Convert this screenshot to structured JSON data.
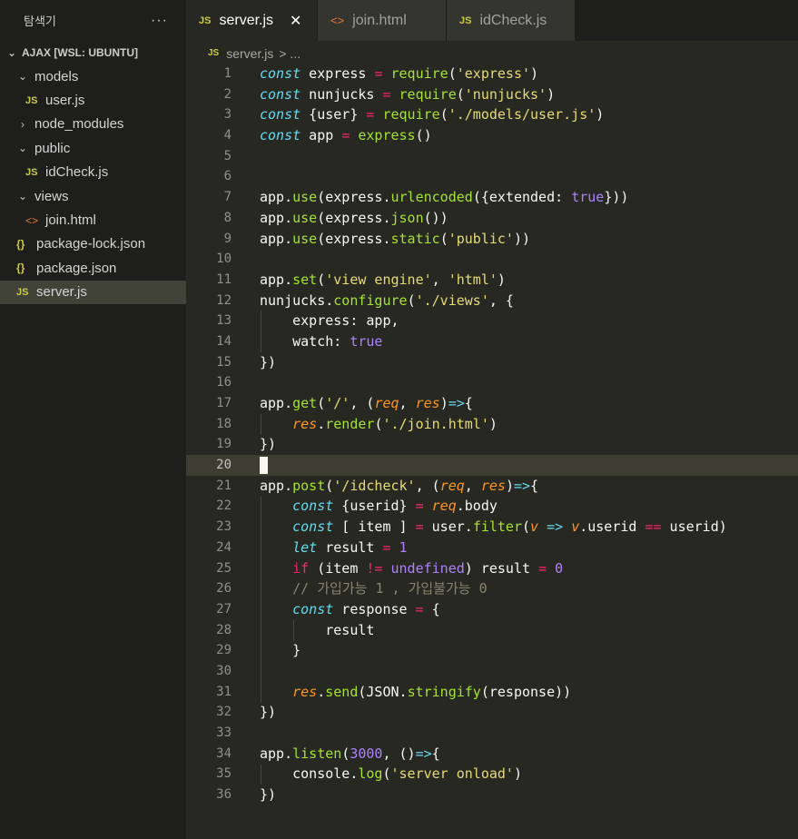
{
  "explorer": {
    "title": "탐색기",
    "more": "···",
    "section": "AJAX [WSL: UBUNTU]",
    "items": [
      {
        "label": "models",
        "kind": "folder-open",
        "indent": 1
      },
      {
        "label": "user.js",
        "kind": "js",
        "indent": 2
      },
      {
        "label": "node_modules",
        "kind": "folder-closed",
        "indent": 1
      },
      {
        "label": "public",
        "kind": "folder-open",
        "indent": 1
      },
      {
        "label": "idCheck.js",
        "kind": "js",
        "indent": 2
      },
      {
        "label": "views",
        "kind": "folder-open",
        "indent": 1
      },
      {
        "label": "join.html",
        "kind": "html",
        "indent": 2
      },
      {
        "label": "package-lock.json",
        "kind": "json",
        "indent": 1
      },
      {
        "label": "package.json",
        "kind": "json",
        "indent": 1
      },
      {
        "label": "server.js",
        "kind": "js",
        "indent": 1,
        "active": true
      }
    ]
  },
  "tabs": [
    {
      "label": "server.js",
      "kind": "js",
      "active": true
    },
    {
      "label": "join.html",
      "kind": "html",
      "active": false
    },
    {
      "label": "idCheck.js",
      "kind": "js",
      "active": false
    }
  ],
  "breadcrumb": {
    "file": "server.js",
    "rest": "> ..."
  },
  "editor": {
    "current_line": 20,
    "lines": [
      [
        [
          "kw",
          "const"
        ],
        [
          "pl",
          " express "
        ],
        [
          "op",
          "="
        ],
        [
          "pl",
          " "
        ],
        [
          "fn",
          "require"
        ],
        [
          "pl",
          "("
        ],
        [
          "str",
          "'express'"
        ],
        [
          "pl",
          ")"
        ]
      ],
      [
        [
          "kw",
          "const"
        ],
        [
          "pl",
          " nunjucks "
        ],
        [
          "op",
          "="
        ],
        [
          "pl",
          " "
        ],
        [
          "fn",
          "require"
        ],
        [
          "pl",
          "("
        ],
        [
          "str",
          "'nunjucks'"
        ],
        [
          "pl",
          ")"
        ]
      ],
      [
        [
          "kw",
          "const"
        ],
        [
          "pl",
          " {user} "
        ],
        [
          "op",
          "="
        ],
        [
          "pl",
          " "
        ],
        [
          "fn",
          "require"
        ],
        [
          "pl",
          "("
        ],
        [
          "str",
          "'./models/user.js'"
        ],
        [
          "pl",
          ")"
        ]
      ],
      [
        [
          "kw",
          "const"
        ],
        [
          "pl",
          " app "
        ],
        [
          "op",
          "="
        ],
        [
          "pl",
          " "
        ],
        [
          "fn",
          "express"
        ],
        [
          "pl",
          "()"
        ]
      ],
      [],
      [],
      [
        [
          "pl",
          "app."
        ],
        [
          "fn",
          "use"
        ],
        [
          "pl",
          "(express."
        ],
        [
          "fn",
          "urlencoded"
        ],
        [
          "pl",
          "({extended: "
        ],
        [
          "num",
          "true"
        ],
        [
          "pl",
          "}))"
        ]
      ],
      [
        [
          "pl",
          "app."
        ],
        [
          "fn",
          "use"
        ],
        [
          "pl",
          "(express."
        ],
        [
          "fn",
          "json"
        ],
        [
          "pl",
          "())"
        ]
      ],
      [
        [
          "pl",
          "app."
        ],
        [
          "fn",
          "use"
        ],
        [
          "pl",
          "(express."
        ],
        [
          "fn",
          "static"
        ],
        [
          "pl",
          "("
        ],
        [
          "str",
          "'public'"
        ],
        [
          "pl",
          "))"
        ]
      ],
      [],
      [
        [
          "pl",
          "app."
        ],
        [
          "fn",
          "set"
        ],
        [
          "pl",
          "("
        ],
        [
          "str",
          "'view engine'"
        ],
        [
          "pl",
          ", "
        ],
        [
          "str",
          "'html'"
        ],
        [
          "pl",
          ")"
        ]
      ],
      [
        [
          "pl",
          "nunjucks."
        ],
        [
          "fn",
          "configure"
        ],
        [
          "pl",
          "("
        ],
        [
          "str",
          "'./views'"
        ],
        [
          "pl",
          ", {"
        ]
      ],
      [
        [
          "pl",
          "    express: app,"
        ]
      ],
      [
        [
          "pl",
          "    watch: "
        ],
        [
          "num",
          "true"
        ]
      ],
      [
        [
          "pl",
          "})"
        ]
      ],
      [],
      [
        [
          "pl",
          "app."
        ],
        [
          "fn",
          "get"
        ],
        [
          "pl",
          "("
        ],
        [
          "str",
          "'/'"
        ],
        [
          "pl",
          ", ("
        ],
        [
          "par",
          "req"
        ],
        [
          "pl",
          ", "
        ],
        [
          "par",
          "res"
        ],
        [
          "pl",
          ")"
        ],
        [
          "kw",
          "=>"
        ],
        [
          "pl",
          "{"
        ]
      ],
      [
        [
          "pl",
          "    "
        ],
        [
          "par",
          "res"
        ],
        [
          "pl",
          "."
        ],
        [
          "fn",
          "render"
        ],
        [
          "pl",
          "("
        ],
        [
          "str",
          "'./join.html'"
        ],
        [
          "pl",
          ")"
        ]
      ],
      [
        [
          "pl",
          "})"
        ]
      ],
      [],
      [
        [
          "pl",
          "app."
        ],
        [
          "fn",
          "post"
        ],
        [
          "pl",
          "("
        ],
        [
          "str",
          "'/idcheck'"
        ],
        [
          "pl",
          ", ("
        ],
        [
          "par",
          "req"
        ],
        [
          "pl",
          ", "
        ],
        [
          "par",
          "res"
        ],
        [
          "pl",
          ")"
        ],
        [
          "kw",
          "=>"
        ],
        [
          "pl",
          "{"
        ]
      ],
      [
        [
          "pl",
          "    "
        ],
        [
          "kw",
          "const"
        ],
        [
          "pl",
          " {userid} "
        ],
        [
          "op",
          "="
        ],
        [
          "pl",
          " "
        ],
        [
          "par",
          "req"
        ],
        [
          "pl",
          ".body"
        ]
      ],
      [
        [
          "pl",
          "    "
        ],
        [
          "kw",
          "const"
        ],
        [
          "pl",
          " [ item ] "
        ],
        [
          "op",
          "="
        ],
        [
          "pl",
          " user."
        ],
        [
          "fn",
          "filter"
        ],
        [
          "pl",
          "("
        ],
        [
          "par",
          "v"
        ],
        [
          "pl",
          " "
        ],
        [
          "kw",
          "=>"
        ],
        [
          "pl",
          " "
        ],
        [
          "par",
          "v"
        ],
        [
          "pl",
          ".userid "
        ],
        [
          "op",
          "=="
        ],
        [
          "pl",
          " userid)"
        ]
      ],
      [
        [
          "pl",
          "    "
        ],
        [
          "kw",
          "let"
        ],
        [
          "pl",
          " result "
        ],
        [
          "op",
          "="
        ],
        [
          "pl",
          " "
        ],
        [
          "num",
          "1"
        ]
      ],
      [
        [
          "pl",
          "    "
        ],
        [
          "kr",
          "if"
        ],
        [
          "pl",
          " (item "
        ],
        [
          "op",
          "!="
        ],
        [
          "pl",
          " "
        ],
        [
          "num",
          "undefined"
        ],
        [
          "pl",
          ") result "
        ],
        [
          "op",
          "="
        ],
        [
          "pl",
          " "
        ],
        [
          "num",
          "0"
        ]
      ],
      [
        [
          "pl",
          "    "
        ],
        [
          "cm",
          "// 가입가능 1 , 가입불가능 0"
        ]
      ],
      [
        [
          "pl",
          "    "
        ],
        [
          "kw",
          "const"
        ],
        [
          "pl",
          " response "
        ],
        [
          "op",
          "="
        ],
        [
          "pl",
          " {"
        ]
      ],
      [
        [
          "pl",
          "        result"
        ]
      ],
      [
        [
          "pl",
          "    }"
        ]
      ],
      [],
      [
        [
          "pl",
          "    "
        ],
        [
          "par",
          "res"
        ],
        [
          "pl",
          "."
        ],
        [
          "fn",
          "send"
        ],
        [
          "pl",
          "(JSON."
        ],
        [
          "fn",
          "stringify"
        ],
        [
          "pl",
          "(response))"
        ]
      ],
      [
        [
          "pl",
          "})"
        ]
      ],
      [],
      [
        [
          "pl",
          "app."
        ],
        [
          "fn",
          "listen"
        ],
        [
          "pl",
          "("
        ],
        [
          "num",
          "3000"
        ],
        [
          "pl",
          ", ()"
        ],
        [
          "kw",
          "=>"
        ],
        [
          "pl",
          "{"
        ]
      ],
      [
        [
          "pl",
          "    console."
        ],
        [
          "fn",
          "log"
        ],
        [
          "pl",
          "("
        ],
        [
          "str",
          "'server onload'"
        ],
        [
          "pl",
          ")"
        ]
      ],
      [
        [
          "pl",
          "})"
        ]
      ]
    ]
  }
}
